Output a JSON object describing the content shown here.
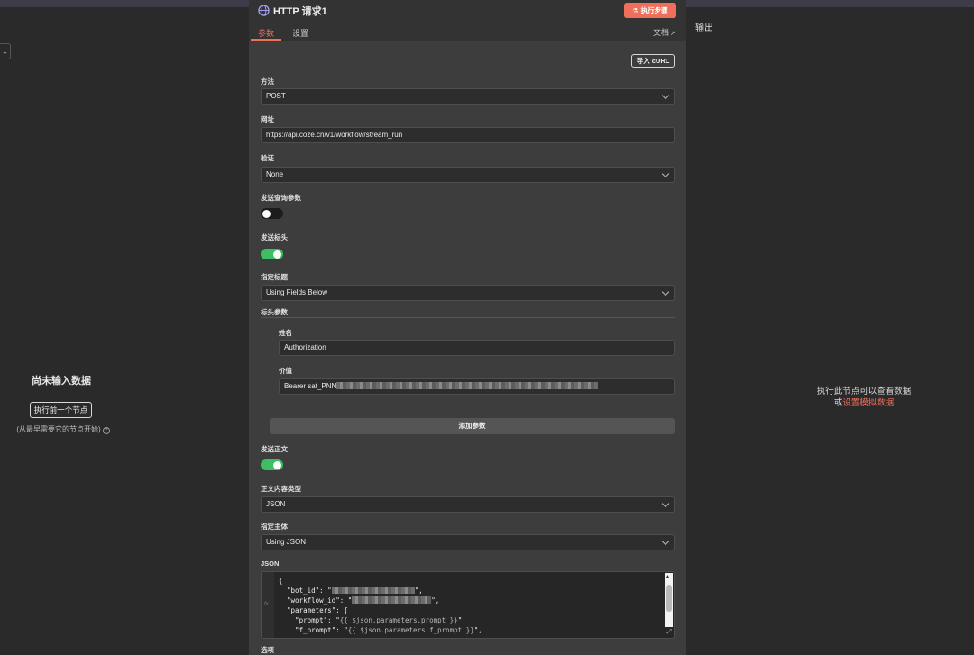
{
  "left": {
    "collapse_icon": "chevron-down-icon",
    "title": "尚未输入数据",
    "button": "执行前一个节点",
    "hint": "(从最早需要它的节点开始)",
    "hint_icon": "?"
  },
  "node": {
    "icon": "globe-icon",
    "title": "HTTP 请求1",
    "execute_button": "执行步骤",
    "tabs": [
      "参数",
      "设置"
    ],
    "docs_label": "文档",
    "curl_button": "导入 cURL",
    "method_label": "方法",
    "method_value": "POST",
    "url_label": "网址",
    "url_value": "https://api.coze.cn/v1/workflow/stream_run",
    "auth_label": "验证",
    "auth_value": "None",
    "send_query_label": "发送查询参数",
    "send_query_on": false,
    "send_headers_label": "发送标头",
    "send_headers_on": true,
    "specify_headers_label": "指定标题",
    "specify_headers_value": "Using Fields Below",
    "header_params_label": "标头参数",
    "header_name_label": "姓名",
    "header_name_value": "Authorization",
    "header_value_label": "价值",
    "header_value_value": "Bearer sat_PNN",
    "add_param_button": "添加参数",
    "send_body_label": "发送正文",
    "send_body_on": true,
    "body_type_label": "正文内容类型",
    "body_type_value": "JSON",
    "specify_body_label": "指定主体",
    "specify_body_value": "Using JSON",
    "json_label": "JSON",
    "json_gutter": "fx",
    "json_lines": {
      "l1": "{",
      "l2": "  \"bot_id\": \"",
      "l2_end": "\",",
      "l3": "  \"workflow_id\": \"",
      "l3_end": "\",",
      "l4": "  \"parameters\": {",
      "l5": "    \"prompt\": \"",
      "l5_tpl": "{{ $json.parameters.prompt }}",
      "l5_end": "\",",
      "l6": "    \"f_prompt\": \"",
      "l6_tpl": "{{ $json.parameters.f_prompt }}",
      "l6_end": "\","
    },
    "options_label": "选项"
  },
  "right": {
    "title": "输出",
    "message": "执行此节点可以查看数据",
    "or_text": "或",
    "link": "设置模拟数据"
  },
  "colors": {
    "accent": "#ef6f5b",
    "toggle_on": "#3dbe63",
    "panel_bg": "#3d3d3e",
    "page_bg": "#2a2a2b"
  }
}
